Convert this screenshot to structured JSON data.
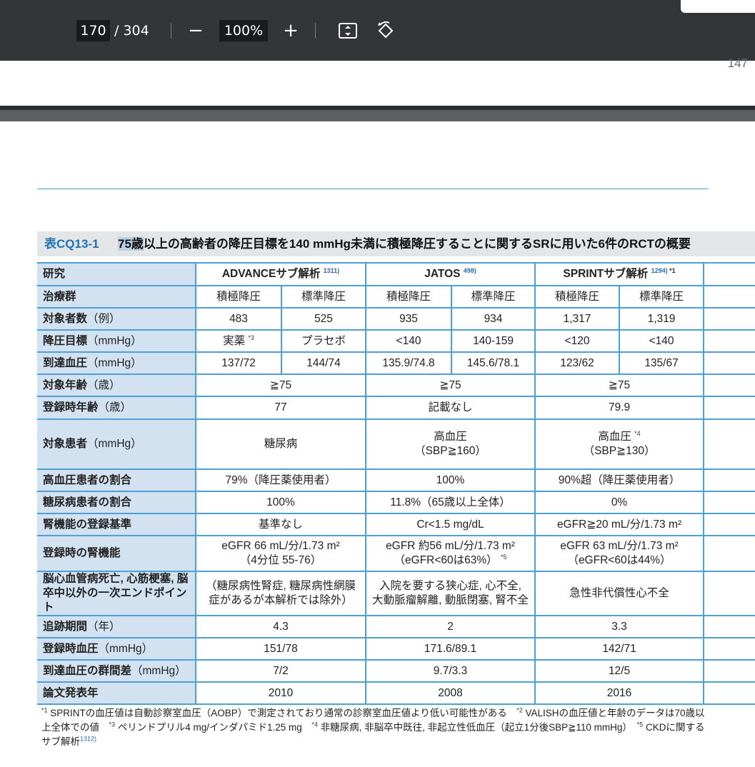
{
  "toolbar": {
    "page_current": "170",
    "page_total": "/ 304",
    "zoom": "100%",
    "zoom_out_glyph": "−",
    "zoom_in_glyph": "+",
    "icons": [
      "zoom-out-icon",
      "zoom-in-icon",
      "fit-page-icon",
      "rotate-icon"
    ]
  },
  "prev_page": {
    "page_number": "147"
  },
  "table": {
    "label": "表CQ13-1",
    "title_highlight": "75歳",
    "title_rest": "以上の高齢者の降圧目標を140 mmHg未満に積極降圧することに関するSRに用いた6件のRCTの概要",
    "header": {
      "row_label": "研究",
      "studies": [
        {
          "name": "ADVANCEサブ解析",
          "ref": "1311)",
          "note": ""
        },
        {
          "name": "JATOS",
          "ref": "498)",
          "note": ""
        },
        {
          "name": "SPRINTサブ解析",
          "ref": "1294)",
          "note": "*1"
        }
      ]
    },
    "rows": [
      {
        "label": "治療群",
        "unit": "",
        "cells": [
          "積極降圧",
          "標準降圧",
          "積極降圧",
          "標準降圧",
          "積極降圧",
          "標準降圧"
        ]
      },
      {
        "label": "対象者数",
        "unit": "（例）",
        "cells": [
          "483",
          "525",
          "935",
          "934",
          "1,317",
          "1,319"
        ]
      },
      {
        "label": "降圧目標",
        "unit": "（mmHg）",
        "cells": [
          "実薬 *3",
          "プラセボ",
          "<140",
          "140-159",
          "<120",
          "<140"
        ]
      },
      {
        "label": "到達血圧",
        "unit": "（mmHg）",
        "cells": [
          "137/72",
          "144/74",
          "135.9/74.8",
          "145.6/78.1",
          "123/62",
          "135/67"
        ]
      },
      {
        "label": "対象年齢",
        "unit": "（歳）",
        "cells": [
          "≧75",
          "≧75",
          "≧75"
        ]
      },
      {
        "label": "登録時年齢",
        "unit": "（歳）",
        "cells": [
          "77",
          "記載なし",
          "79.9"
        ]
      },
      {
        "label": "対象患者",
        "unit": "（mmHg）",
        "cells": [
          "糖尿病",
          "高血圧|（SBP≧160）",
          "高血圧 *4|（SBP≧130）"
        ]
      },
      {
        "label": "高血圧患者の割合",
        "unit": "",
        "cells": [
          "79%（降圧薬使用者）",
          "100%",
          "90%超（降圧薬使用者）"
        ]
      },
      {
        "label": "糖尿病患者の割合",
        "unit": "",
        "cells": [
          "100%",
          "11.8%（65歳以上全体）",
          "0%"
        ]
      },
      {
        "label": "腎機能の登録基準",
        "unit": "",
        "cells": [
          "基準なし",
          "Cr<1.5 mg/dL",
          "eGFR≧20 mL/分/1.73 m²"
        ]
      },
      {
        "label": "登録時の腎機能",
        "unit": "",
        "cells": [
          "eGFR 66 mL/分/1.73 m²|（4分位 55-76）",
          "eGFR 約56 mL/分/1.73 m²|（eGFR<60は63%）*5",
          "eGFR 63 mL/分/1.73 m²|（eGFR<60は44%）"
        ]
      },
      {
        "label": "脳心血管病死亡, 心筋梗塞, 脳卒中以外の一次エンドポイント",
        "unit": "",
        "cells": [
          "（糖尿病性腎症, 糖尿病性網膜|症があるが本解析では除外）",
          "入院を要する狭心症, 心不全,|大動脈瘤解離, 動脈閉塞, 腎不全",
          "急性非代償性心不全"
        ]
      },
      {
        "label": "追跡期間",
        "unit": "（年）",
        "cells": [
          "4.3",
          "2",
          "3.3"
        ]
      },
      {
        "label": "登録時血圧",
        "unit": "（mmHg）",
        "cells": [
          "151/78",
          "171.6/89.1",
          "142/71"
        ]
      },
      {
        "label": "到達血圧の群間差",
        "unit": "（mmHg）",
        "cells": [
          "7/2",
          "9.7/3.3",
          "12/5"
        ]
      },
      {
        "label": "論文発表年",
        "unit": "",
        "cells": [
          "2010",
          "2008",
          "2016"
        ]
      }
    ]
  },
  "footnote": "*1 SPRINTの血圧値は自動診察室血圧（AOBP）で測定されており通常の診察室血圧値より低い可能性がある　*2 VALISHの血圧値と年齢のデータは70歳以上全体での値　*3 ペリンドプリル4 mg/インダパミド1.25 mg　*4 非糖尿病, 非脳卒中既往, 非起立性低血圧（起立1分後SBP≧110 mmHg）　*5 CKDに関するサブ解析1312)"
}
